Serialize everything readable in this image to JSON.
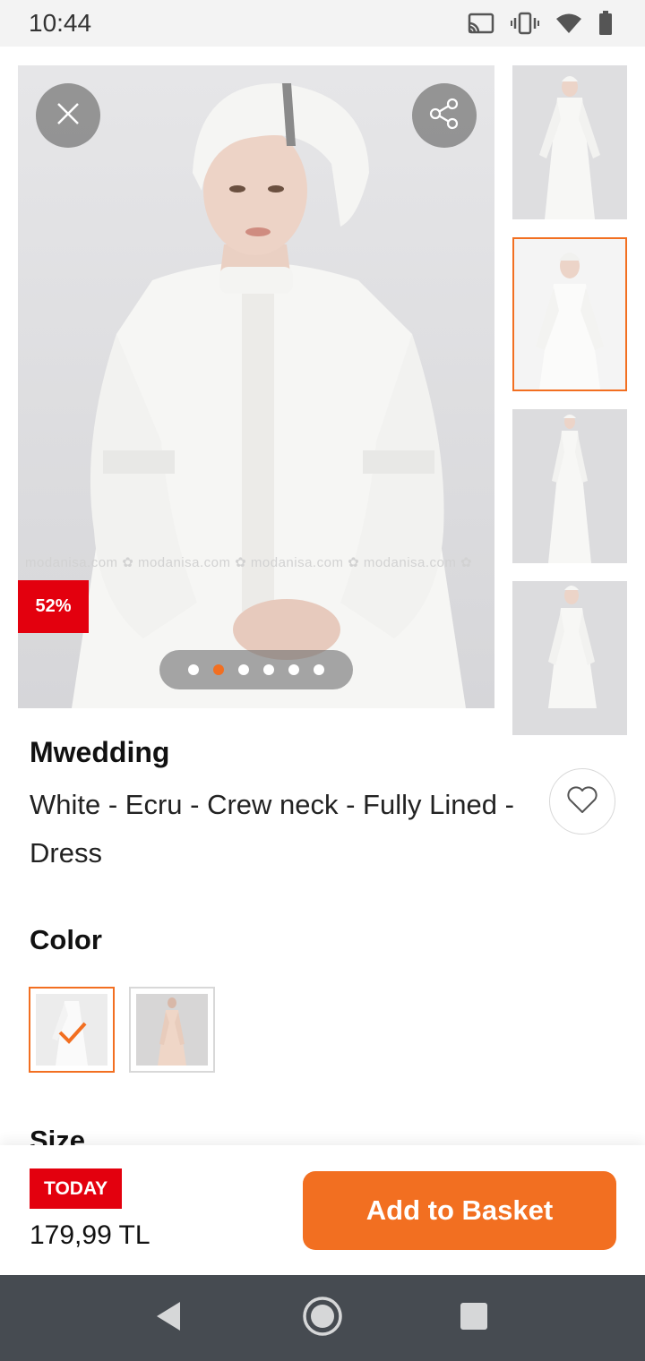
{
  "status_bar": {
    "time": "10:44",
    "icons": [
      "cast-icon",
      "vibrate-icon",
      "wifi-icon",
      "battery-icon"
    ]
  },
  "gallery": {
    "watermark_text": "modanisa.com ✿ modanisa.com ✿ modanisa.com ✿ modanisa.com ✿",
    "discount": "52%",
    "image_count": 6,
    "active_image": 2,
    "thumbnails": [
      "thumbnail-1",
      "thumbnail-2",
      "thumbnail-3",
      "thumbnail-4"
    ],
    "selected_thumbnail": 2
  },
  "product": {
    "brand": "Mwedding",
    "name": "White - Ecru - Crew neck - Fully Lined - Dress"
  },
  "color_section": {
    "label": "Color",
    "options": [
      "white-ecru",
      "powder"
    ],
    "selected": 0
  },
  "size_section": {
    "label": "Size"
  },
  "bottom_bar": {
    "badge": "TODAY",
    "price": "179,99 TL",
    "cta": "Add to Basket"
  },
  "colors": {
    "accent": "#f26f21",
    "badge_red": "#e3000e",
    "nav_bar": "#464b51"
  }
}
